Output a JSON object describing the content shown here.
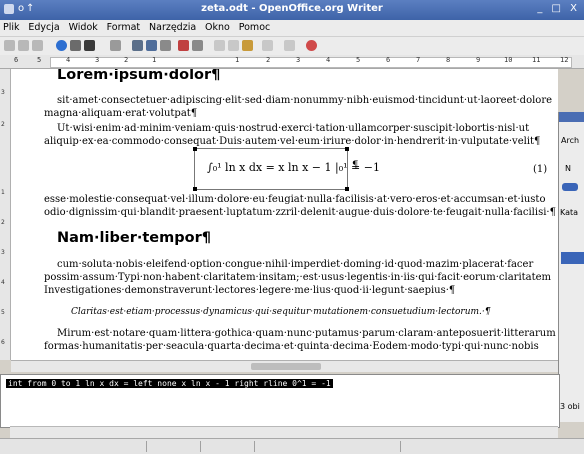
{
  "window": {
    "title": "zeta.odt - OpenOffice.org Writer",
    "controls": "_ □ X"
  },
  "menu": [
    "Plik",
    "Edycja",
    "Widok",
    "Format",
    "Narzędzia",
    "Okno",
    "Pomoc"
  ],
  "ruler": {
    "labels": [
      "6",
      "5",
      "4",
      "3",
      "2",
      "1",
      "1",
      "2",
      "3",
      "4",
      "5",
      "6",
      "7",
      "8",
      "9",
      "10",
      "11",
      "12"
    ]
  },
  "document": {
    "heading1": "Lorem·ipsum·dolor¶",
    "p1_l1": "sit·amet·consectetuer·adipiscing·elit·sed·diam·nonummy·nibh·euismod·tincidunt·ut·laoreet·dolore",
    "p1_l2": "magna·aliquam·erat·volutpat¶",
    "p2_l1": "Ut·wisi·enim·ad·minim·veniam·quis·nostrud·exerci·tation·ullamcorper·suscipit·lobortis·nisl·ut",
    "p2_l2": "aliquip·ex·ea·commodo·consequat·Duis·autem·vel·eum·iriure·dolor·in·hendrerit·in·vulputate·velit¶",
    "formula_display": "∫₀¹ ln x dx = x ln x − 1 |₀¹ = −1",
    "formula_end": "¶",
    "eq_number": "(1)",
    "p3_l1": "esse·molestie·consequat·vel·illum·dolore·eu·feugiat·nulla·facilisis·at·vero·eros·et·accumsan·et·iusto",
    "p3_l2": "odio·dignissim·qui·blandit·praesent·luptatum·zzril·delenit·augue·duis·dolore·te·feugait·nulla·facilisi·¶",
    "heading2": "Nam·liber·tempor¶",
    "p4_l1": "cum·soluta·nobis·eleifend·option·congue·nihil·imperdiet·doming·id·quod·mazim·placerat·facer",
    "p4_l2": "possim·assum·Typi·non·habent·claritatem·insitam;·est·usus·legentis·in·iis·qui·facit·eorum·claritatem",
    "p4_l3": "Investigationes·demonstraverunt·lectores·legere·me·lius·quod·ii·legunt·saepius·¶",
    "p5": "Claritas·est·etiam·processus·dynamicus·qui·sequitur·mutationem·consuetudium·lectorum.·¶",
    "p6_l1": "Mirum·est·notare·quam·littera·gothica·quam·nunc·putamus·parum·claram·anteposuerit·litterarum",
    "p6_l2": "formas·humanitatis·per·seacula·quarta·decima·et·quinta·decima·Eodem·modo·typi·qui·nunc·nobis"
  },
  "command": {
    "text": "int from 0 to 1 ln x dx = left none x ln x - 1 right rline 0^1 = -1"
  },
  "side_window": {
    "menu1": "Arch",
    "label_n": "N",
    "label_kata": "Kata",
    "status": "3 obi"
  }
}
